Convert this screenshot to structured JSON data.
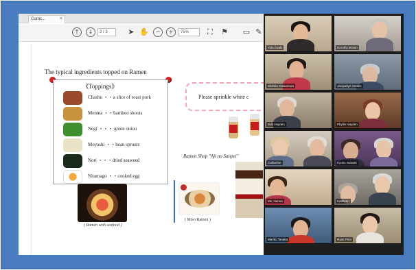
{
  "pdf_viewer": {
    "tab_label": "Curric...",
    "tab_close": "×",
    "page_indicator": "3 / 3",
    "zoom": "75%"
  },
  "slide": {
    "heading": "The typical ingredients topped on Ramen",
    "toppings_title": "《Toppings》",
    "toppings": [
      {
        "name": "Chashu",
        "desc": "・・a slice of roast pork",
        "color": "#9b4a2c"
      },
      {
        "name": "Menma",
        "desc": "・・bamboo shoots",
        "color": "#c9933e"
      },
      {
        "name": "Negi",
        "desc": "・・・ green onion",
        "color": "#3f8f2f"
      },
      {
        "name": "Moyashi",
        "desc": "・・bean sprouts",
        "color": "#e8e2c6"
      },
      {
        "name": "Nori",
        "desc": "・・・dried seaweed",
        "color": "#1a2a1a"
      },
      {
        "name": "Nitamago",
        "desc": "・・cooked egg",
        "color": "#f2a93b"
      }
    ],
    "ramen_caption": "( Ramen with seafood )",
    "sprinkle_text": "Please   sprinkle   white c",
    "shop_title": "Ramen Shop \"Aji no Sanpei\"",
    "miso_caption": "( Miso Ramen )",
    "accent_color": "#3b6fc2"
  },
  "participants": [
    {
      "name": "Yoko Iwaki"
    },
    {
      "name": "Dorothy Brown"
    },
    {
      "name": "Michiko Kawamura"
    },
    {
      "name": "Jacquelyn Gentile"
    },
    {
      "name": "Bob Hayden"
    },
    {
      "name": "Phyllis Hayden"
    },
    {
      "name": "Catherine"
    },
    {
      "name": "Kyoko Iwasaki"
    },
    {
      "name": "Ms. Hanna"
    },
    {
      "name": "Kathleen"
    },
    {
      "name": "Mariko Tanaka"
    },
    {
      "name": "Ryan Prior"
    },
    {
      "name": "Nobuko Kaneda"
    },
    {
      "name": "Nobuko Sato"
    }
  ]
}
